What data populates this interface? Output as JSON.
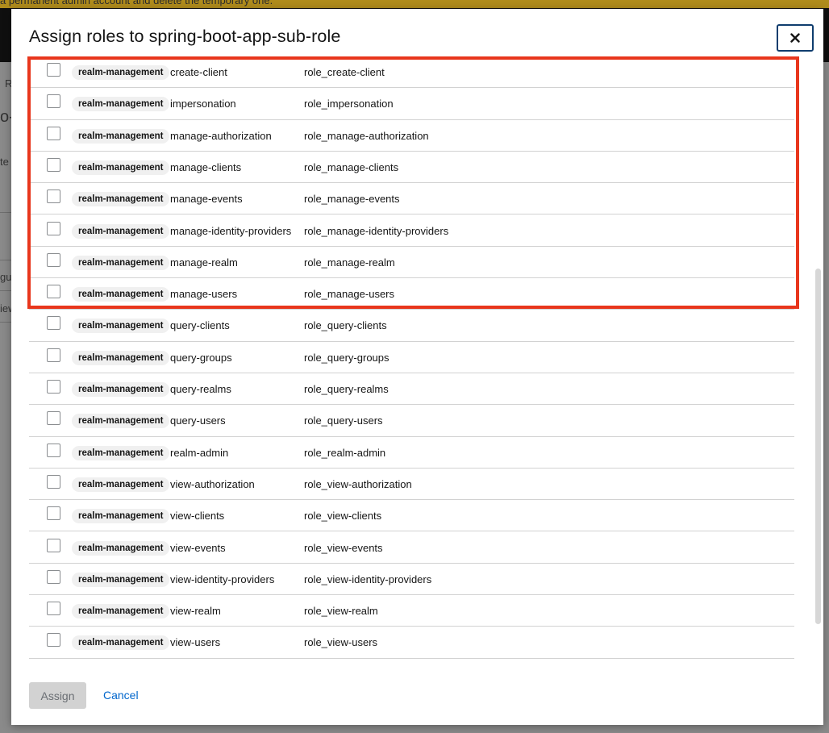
{
  "background": {
    "banner_text": "a permanent admin account and delete the temporary one.",
    "fragments": [
      "R",
      "o-",
      "te",
      "gue",
      "iew"
    ]
  },
  "modal": {
    "title": "Assign roles to spring-boot-app-sub-role",
    "close_label": "×",
    "rows": [
      {
        "client": "realm-management",
        "name": "create-client",
        "description": "role_create-client"
      },
      {
        "client": "realm-management",
        "name": "impersonation",
        "description": "role_impersonation"
      },
      {
        "client": "realm-management",
        "name": "manage-authorization",
        "description": "role_manage-authorization"
      },
      {
        "client": "realm-management",
        "name": "manage-clients",
        "description": "role_manage-clients"
      },
      {
        "client": "realm-management",
        "name": "manage-events",
        "description": "role_manage-events"
      },
      {
        "client": "realm-management",
        "name": "manage-identity-providers",
        "description": "role_manage-identity-providers"
      },
      {
        "client": "realm-management",
        "name": "manage-realm",
        "description": "role_manage-realm"
      },
      {
        "client": "realm-management",
        "name": "manage-users",
        "description": "role_manage-users"
      },
      {
        "client": "realm-management",
        "name": "query-clients",
        "description": "role_query-clients"
      },
      {
        "client": "realm-management",
        "name": "query-groups",
        "description": "role_query-groups"
      },
      {
        "client": "realm-management",
        "name": "query-realms",
        "description": "role_query-realms"
      },
      {
        "client": "realm-management",
        "name": "query-users",
        "description": "role_query-users"
      },
      {
        "client": "realm-management",
        "name": "realm-admin",
        "description": "role_realm-admin"
      },
      {
        "client": "realm-management",
        "name": "view-authorization",
        "description": "role_view-authorization"
      },
      {
        "client": "realm-management",
        "name": "view-clients",
        "description": "role_view-clients"
      },
      {
        "client": "realm-management",
        "name": "view-events",
        "description": "role_view-events"
      },
      {
        "client": "realm-management",
        "name": "view-identity-providers",
        "description": "role_view-identity-providers"
      },
      {
        "client": "realm-management",
        "name": "view-realm",
        "description": "role_view-realm"
      },
      {
        "client": "realm-management",
        "name": "view-users",
        "description": "role_view-users"
      }
    ],
    "assign_label": "Assign",
    "cancel_label": "Cancel"
  },
  "colors": {
    "highlight": "#e8361c",
    "link": "#0066cc",
    "banner": "#b08c1c"
  }
}
